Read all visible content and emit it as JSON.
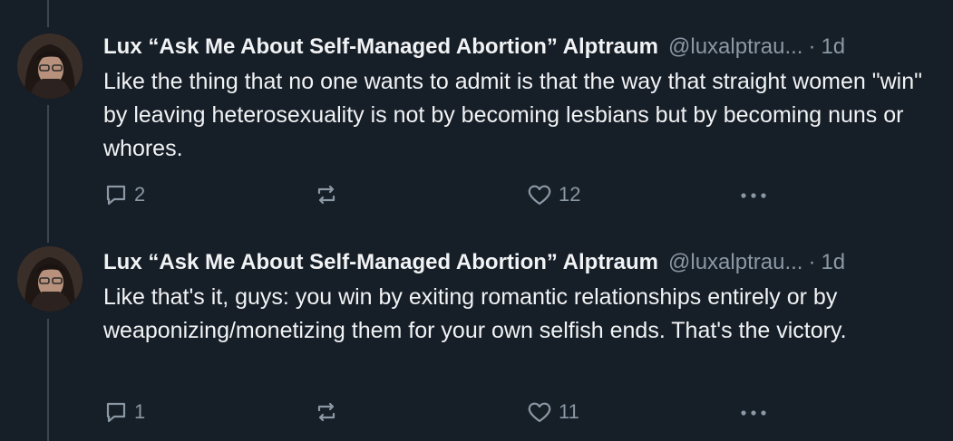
{
  "posts": [
    {
      "author": "Lux “Ask Me About Self-Managed Abortion” Alptraum",
      "handle": "@luxalptrau...",
      "separator": "·",
      "time": "1d",
      "text": "Like the thing that no one wants to admit is that the way that straight women \"win\" by leaving heterosexuality is not by becoming lesbians but by becoming nuns or whores.",
      "reply_count": "2",
      "repost_count": "",
      "like_count": "12",
      "icons": [
        "reply-icon",
        "repost-icon",
        "heart-icon",
        "more-icon"
      ]
    },
    {
      "author": "Lux “Ask Me About Self-Managed Abortion” Alptraum",
      "handle": "@luxalptrau...",
      "separator": "·",
      "time": "1d",
      "text": "Like that's it, guys: you win by exiting romantic relationships entirely or by weaponizing/monetizing them for your own selfish ends. That's the victory.",
      "reply_count": "1",
      "repost_count": "",
      "like_count": "11",
      "icons": [
        "reply-icon",
        "repost-icon",
        "heart-icon",
        "more-icon"
      ]
    }
  ],
  "colors": {
    "background": "#161e27",
    "text": "#f1f3f5",
    "muted": "#8b98a5",
    "thread_line": "#3b4450"
  }
}
